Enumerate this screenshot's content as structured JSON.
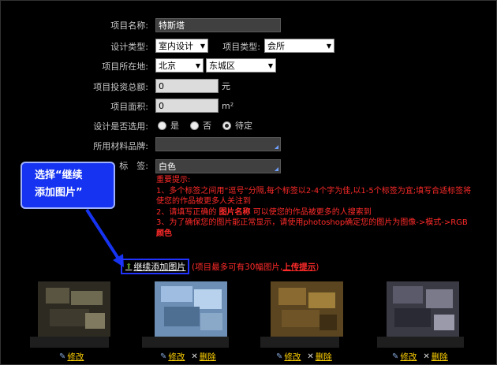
{
  "form": {
    "project_name": {
      "label": "项目名称:",
      "value": "特斯塔"
    },
    "design_type": {
      "label": "设计类型:",
      "value": "室内设计"
    },
    "project_type": {
      "label": "项目类型:",
      "value": "会所"
    },
    "location": {
      "label": "项目所在地:",
      "city": "北京",
      "district": "东城区"
    },
    "investment": {
      "label": "项目投资总额:",
      "value": "0",
      "unit": "元"
    },
    "area": {
      "label": "项目面积:",
      "value": "0",
      "unit": "m²"
    },
    "selected": {
      "label": "设计是否选用:",
      "options": [
        "是",
        "否",
        "待定"
      ],
      "checked": "待定"
    },
    "material": {
      "label": "所用材料品牌:",
      "value": ""
    },
    "tags": {
      "label": "标　签:",
      "value": "白色"
    }
  },
  "notice": {
    "title": "重要提示:",
    "line1": "1、多个标签之间用“逗号”分隔,每个标签以2-4个字为佳,以1-5个标签为宜;填写合适标签将",
    "line1b": "使您的作品被更多人关注到",
    "line2a": "2、请填写正确的",
    "line2b": "图片名称",
    "line2c": "可以使您的作品被更多的人搜索到",
    "line3": "3、为了确保您的图片能正常显示，请使用photoshop确定您的图片为图像->模式->RGB",
    "line3b": "颜色"
  },
  "callout": {
    "line1": "选择“继续",
    "line2": "添加图片”"
  },
  "add": {
    "link": "继续添加图片",
    "note": "(项目最多可有30幅图片,",
    "tip": "上传提示",
    "close": ")"
  },
  "thumbs": {
    "edit": "修改",
    "delete": "删除"
  },
  "icons": {
    "add": "upload-arrow-icon",
    "edit": "edit-icon",
    "delete": "delete-x-icon"
  },
  "colors": {
    "background": "#000000",
    "notice": "#ff2a2a",
    "callout": "#1533f0",
    "link": "#ffd200"
  }
}
